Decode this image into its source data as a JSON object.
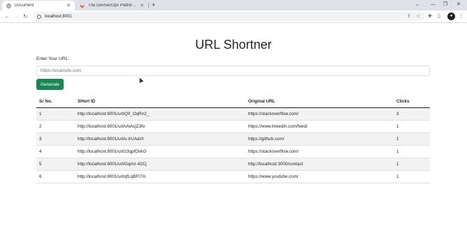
{
  "browser": {
    "tabs": [
      {
        "title": "Document",
        "active": true,
        "icon": "globe-icon"
      },
      {
        "title": "The DevSecOps Platform | GitLab",
        "active": false,
        "icon": "gitlab-icon"
      }
    ],
    "address": "localhost:8001"
  },
  "page": {
    "title": "URL Shortner",
    "input_label": "Enter Your URL:",
    "input_placeholder": "https://example.com",
    "input_value": "",
    "generate_label": "Generate"
  },
  "table": {
    "headers": [
      "Sr No.",
      "SHort ID",
      "Original URL",
      "Clicks"
    ],
    "rows": [
      [
        "1",
        "http://localhost:8001/url/Q0_OqRn2_",
        "https://stackoverflow.com/",
        "3"
      ],
      [
        "2",
        "http://localhost:8001/url/uNAcjZ3fo",
        "https://www.linkedin.com/feed/",
        "1"
      ],
      [
        "3",
        "http://localhost:8001/url/u-IrUAaVt",
        "https://github.com/",
        "1"
      ],
      [
        "4",
        "http://localhost:8001/url/z3qpfOvkG",
        "https://stackoverflow.com/",
        "1"
      ],
      [
        "5",
        "http://localhost:8001/url/Gqmz-42Cj",
        "http://localhost:3000/contact",
        "1"
      ],
      [
        "6",
        "http://localhost:8001/url/qfLqBFt7m",
        "https://www.youtube.com/",
        "1"
      ]
    ]
  },
  "colors": {
    "generate_button": "#198754",
    "stripe": "#f2f2f2",
    "gitlab": "#e24329"
  }
}
